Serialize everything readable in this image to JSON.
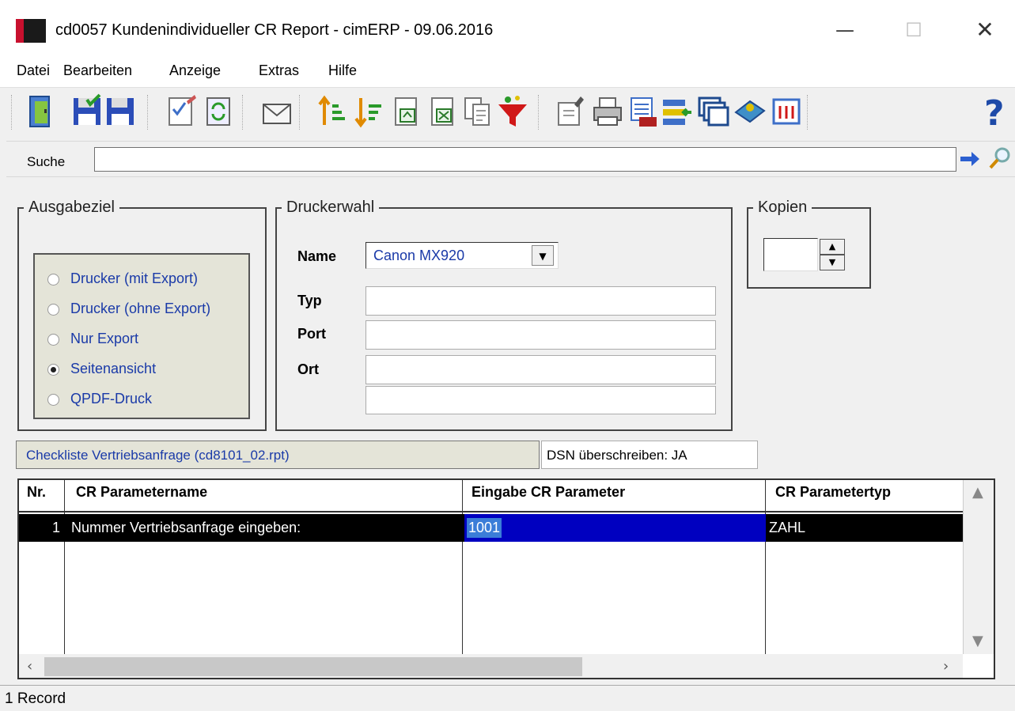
{
  "window": {
    "title": "cd0057 Kundenindividueller CR Report - cimERP - 09.06.2016",
    "minimize": "—",
    "maximize": "☐",
    "close": "✕"
  },
  "menu": [
    "Datei",
    "Bearbeiten",
    "Anzeige",
    "Extras",
    "Hilfe"
  ],
  "toolbar": {
    "icons": [
      "exit-icon",
      "save-check-icon",
      "save-icon",
      "edit-check-icon",
      "refresh-icon",
      "mail-icon",
      "sort-ascending-icon",
      "sort-descending-icon",
      "export-icon",
      "excel-icon",
      "copy-icon",
      "filter-icon",
      "edit-doc-icon",
      "print-icon",
      "calendar-icon",
      "import-icon",
      "windows-icon",
      "book-icon",
      "grid-icon",
      "help-icon"
    ]
  },
  "search": {
    "label": "Suche",
    "value": "",
    "go_icon": "arrow-right-icon",
    "find_icon": "magnifier-icon"
  },
  "ausgabeziel": {
    "title": "Ausgabeziel",
    "options": [
      {
        "label": "Drucker (mit Export)",
        "selected": false
      },
      {
        "label": "Drucker (ohne Export)",
        "selected": false
      },
      {
        "label": "Nur Export",
        "selected": false
      },
      {
        "label": "Seitenansicht",
        "selected": true
      },
      {
        "label": "QPDF-Druck",
        "selected": false
      }
    ]
  },
  "druckerwahl": {
    "title": "Druckerwahl",
    "name_label": "Name",
    "name_value": "Canon MX920",
    "typ_label": "Typ",
    "typ_value": "",
    "port_label": "Port",
    "port_value": "",
    "ort_label": "Ort",
    "ort_value": "",
    "extra_value": ""
  },
  "kopien": {
    "title": "Kopien",
    "value": ""
  },
  "report": {
    "name": "Checkliste Vertriebsanfrage (cd8101_02.rpt)",
    "dsn": "DSN überschreiben: JA"
  },
  "grid": {
    "columns": [
      "Nr.",
      "CR Parametername",
      "Eingabe CR Parameter",
      "CR Parametertyp"
    ],
    "rows": [
      {
        "nr": "1",
        "name": "Nummer Vertriebsanfrage eingeben:",
        "input": "1001",
        "type": "ZAHL"
      }
    ]
  },
  "status": {
    "text": "1 Record"
  },
  "colors": {
    "selection_row": "#000000",
    "selection_cell": "#0000c0",
    "label_blue": "#1a3aa8",
    "panel_beige": "#e4e4d8"
  }
}
